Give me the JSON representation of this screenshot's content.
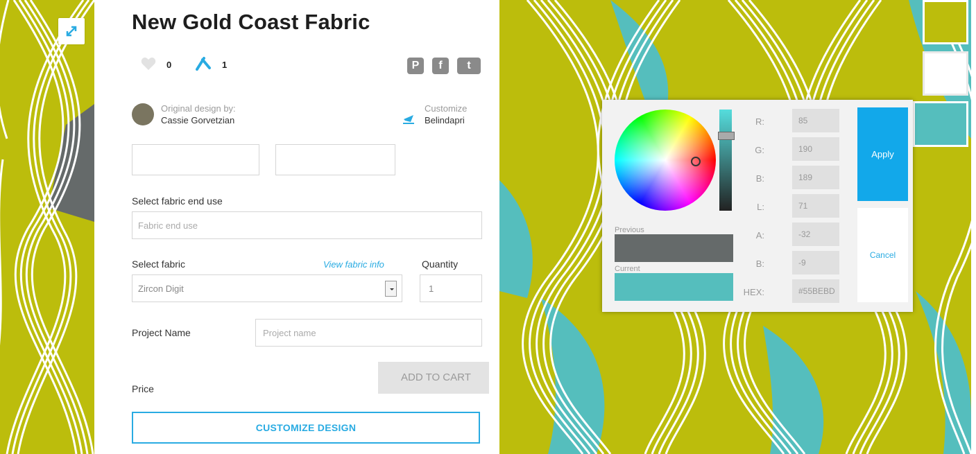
{
  "product": {
    "title": "New Gold Coast Fabric",
    "favorites_count": "0",
    "remix_count": "1",
    "share_icons": [
      "pinterest-icon",
      "facebook-icon",
      "twitter-icon"
    ]
  },
  "credits": {
    "original_label": "Original design by:",
    "original_name": "Cassie Gorvetzian",
    "customized_label": "Customize",
    "customized_name": "Belindapri"
  },
  "fabric_end_use": {
    "label": "Select fabric end use",
    "placeholder": "Fabric end use"
  },
  "fabric": {
    "label": "Select fabric",
    "link": "View fabric info",
    "value": "Zircon Digit"
  },
  "quantity": {
    "label": "Quantity",
    "value": "1"
  },
  "project": {
    "label": "Project Name",
    "placeholder": "Project name"
  },
  "price": {
    "label": "Price"
  },
  "buttons": {
    "add_to_cart": "ADD TO CART",
    "customize": "CUSTOMIZE DESIGN",
    "apply": "Apply",
    "cancel": "Cancel"
  },
  "picker": {
    "previous_label": "Previous",
    "current_label": "Current",
    "previous_color": "#656a6a",
    "current_color": "#55bebd",
    "fields": [
      {
        "label": "R:",
        "value": "85"
      },
      {
        "label": "G:",
        "value": "190"
      },
      {
        "label": "B:",
        "value": "189"
      },
      {
        "label": "L:",
        "value": "71"
      },
      {
        "label": "A:",
        "value": "-32"
      },
      {
        "label": "B:",
        "value": "-9"
      },
      {
        "label": "HEX:",
        "value": "#55BEBD"
      }
    ]
  },
  "colors": {
    "pattern_gold": "#bcbd0c",
    "pattern_teal": "#55bebd",
    "pattern_gray": "#656a6a",
    "accent_blue": "#29abe2",
    "apply_blue": "#12a8ea"
  }
}
